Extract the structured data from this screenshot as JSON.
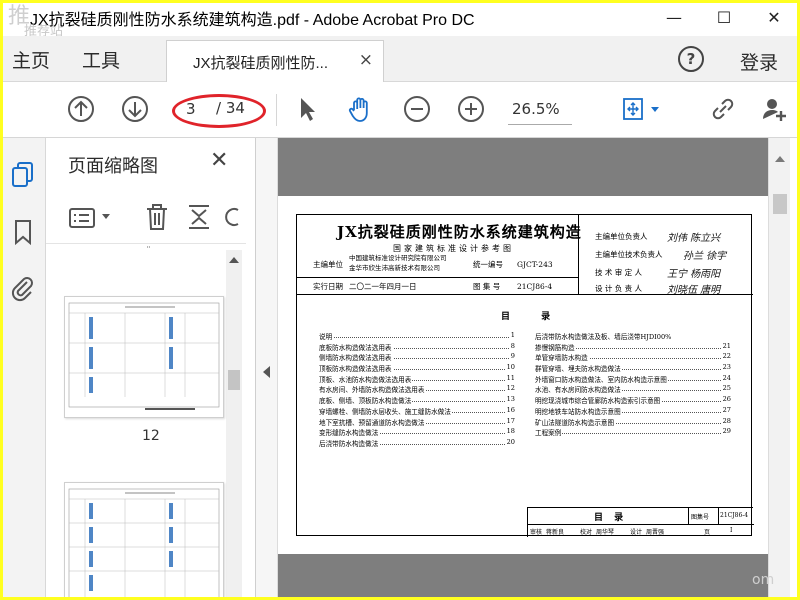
{
  "window": {
    "title": "JX抗裂硅质刚性防水系统建筑构造.pdf - Adobe Acrobat Pro DC",
    "watermark": "推荐站",
    "controls": {
      "minimize": "—",
      "maximize": "☐",
      "close": "✕"
    }
  },
  "menu": {
    "home": "主页",
    "tools": "工具",
    "doc_tab": "JX抗裂硅质刚性防...",
    "doc_tab_close": "×",
    "help": "?",
    "login": "登录"
  },
  "toolbar": {
    "page_current": "3",
    "page_total": "/ 34",
    "zoom": "26.5%",
    "icons": [
      "arrow-up-circle-icon",
      "arrow-down-circle-icon",
      "cursor-icon",
      "hand-icon",
      "zoom-out-icon",
      "zoom-in-icon",
      "fit-page-icon",
      "share-link-icon",
      "add-user-icon"
    ],
    "highlight_color": "#e0232a"
  },
  "nav_icons": [
    "thumbnails-icon",
    "bookmark-icon",
    "attachment-icon"
  ],
  "thumb_panel": {
    "title": "页面缩略图",
    "close": "✕",
    "thumbnails": [
      {
        "number": "12"
      },
      {
        "number": ""
      }
    ]
  },
  "document": {
    "title": "JX抗裂硅质刚性防水系统建筑构造",
    "subtitle": "国家建筑标准设计参考图",
    "editor_label": "主编单位",
    "editor_1": "中国建筑标准设计研究院有限公司",
    "editor_2": "金华市欣生沛高新技术有限公司",
    "code_label": "统一编号",
    "code_value": "GJCT-243",
    "date_label": "实行日期",
    "date_value": "二〇二一年四月一日",
    "atlas_label": "图 集 号",
    "atlas_value": "21CJ86-4",
    "roles": [
      {
        "label": "主编单位负责人",
        "sig": "刘伟  陈立兴"
      },
      {
        "label": "主编单位技术负责人",
        "sig": "孙兰  徐宇"
      },
      {
        "label": "技 术 审 定 人",
        "sig": "王宁  杨雨阳"
      },
      {
        "label": "设 计 负 责 人",
        "sig": "刘晓伍  唐明"
      }
    ],
    "toc_title": "目 录",
    "toc_left": [
      {
        "label": "说明",
        "page": "1"
      },
      {
        "label": "底板防水构造做法选用表",
        "page": "8"
      },
      {
        "label": "侧墙防水构造做法选用表",
        "page": "9"
      },
      {
        "label": "顶板防水构造做法选用表",
        "page": "10"
      },
      {
        "label": "顶板、水池防水构造做法选用表",
        "page": "11"
      },
      {
        "label": "有水房间、外墙防水构造做法选用表",
        "page": "12"
      },
      {
        "label": "底板、侧墙、顶板防水构造做法",
        "page": "13"
      },
      {
        "label": "穿墙螺栓、侧墙防水层收头、施工缝防水做法",
        "page": "16"
      },
      {
        "label": "地下室抗槽、预留通道防水构造做法",
        "page": "17"
      },
      {
        "label": "变形缝防水构造做法",
        "page": "18"
      },
      {
        "label": "后浇带防水构造做法",
        "page": "20"
      }
    ],
    "toc_right": [
      {
        "label": "后浇带防水构造做法及板、墙后浇带HJDI00%",
        "page": ""
      },
      {
        "label": "    掺慢钢筋构造",
        "page": "21"
      },
      {
        "label": "单管穿墙防水构造",
        "page": "22"
      },
      {
        "label": "群管穿墙、埋夫防水构造做法",
        "page": "23"
      },
      {
        "label": "外墙窗口防水构造做法、室内防水构造示意图",
        "page": "24"
      },
      {
        "label": "水池、有水房间防水构造做法",
        "page": "25"
      },
      {
        "label": "明挖现浇城市综合管廊防水构造索引示意图",
        "page": "26"
      },
      {
        "label": "明挖地铁车站防水构造示意图",
        "page": "27"
      },
      {
        "label": "矿山法隧道防水构造示意图",
        "page": "28"
      },
      {
        "label": "工程案例",
        "page": "29"
      }
    ],
    "titleblock": {
      "name": "目 录",
      "atlas_label": "图集号",
      "atlas_value": "21CJ86-4",
      "row": [
        "审核",
        "蒋新良",
        "校对",
        "周华琴",
        "设计",
        "周晋强",
        "页",
        "I"
      ]
    }
  },
  "corner_watermark": "om"
}
